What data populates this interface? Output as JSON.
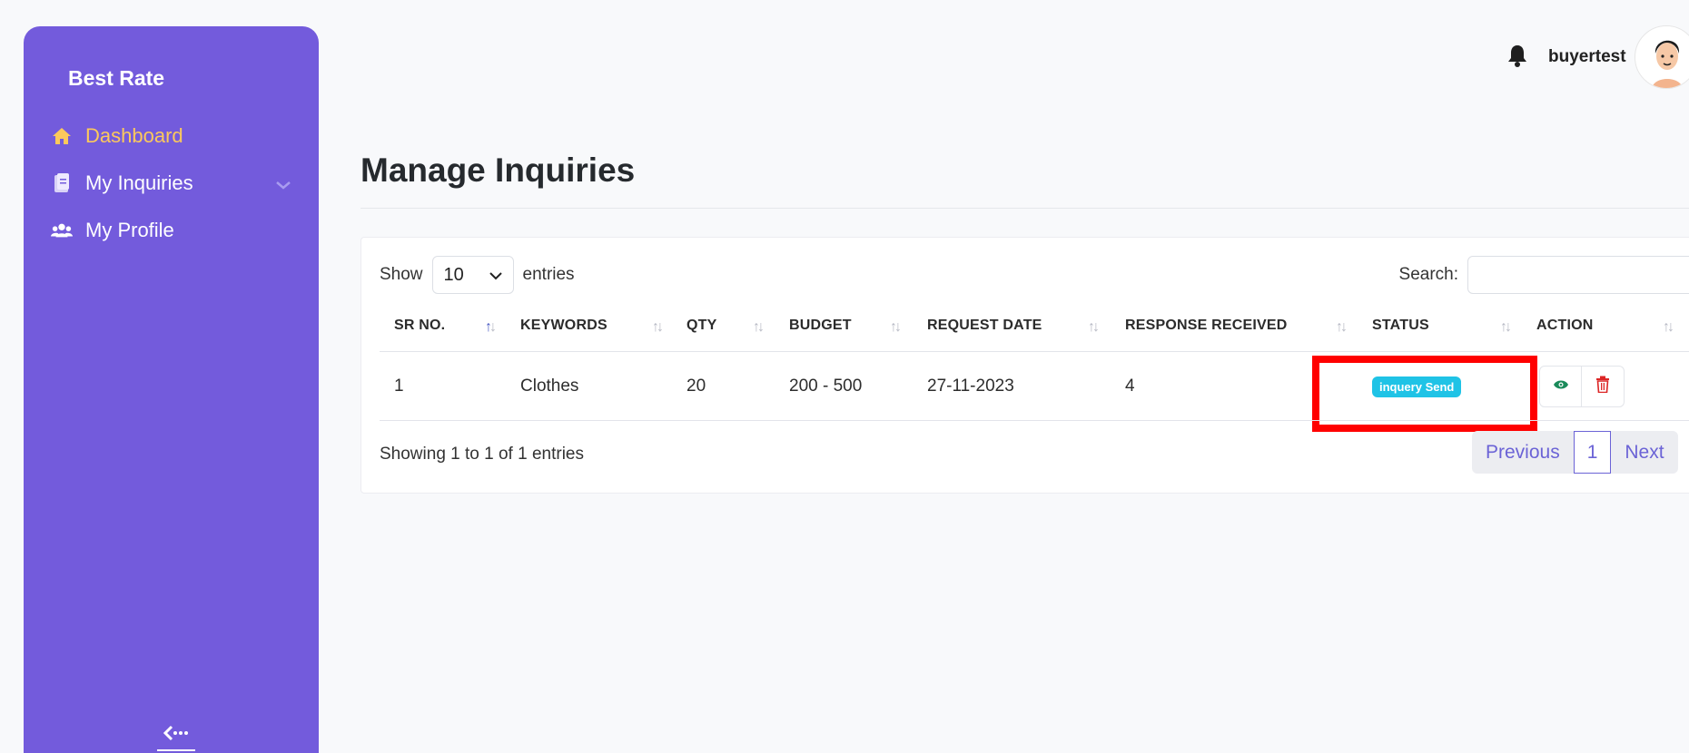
{
  "sidebar": {
    "brand": "Best Rate",
    "items": [
      {
        "label": "Dashboard",
        "icon": "home-icon",
        "active": true
      },
      {
        "label": "My Inquiries",
        "icon": "document-icon",
        "has_submenu": true
      },
      {
        "label": "My Profile",
        "icon": "users-icon"
      }
    ],
    "collapse_icon": "collapse-icon"
  },
  "header": {
    "username": "buyertest",
    "notification_icon": "bell-icon"
  },
  "page": {
    "title": "Manage Inquiries"
  },
  "table_controls": {
    "show_label": "Show",
    "length_value": "10",
    "entries_label": "entries",
    "search_label": "Search:",
    "search_value": ""
  },
  "table": {
    "columns": [
      "SR NO.",
      "KEYWORDS",
      "QTY",
      "BUDGET",
      "REQUEST DATE",
      "RESPONSE RECEIVED",
      "STATUS",
      "ACTION"
    ],
    "rows": [
      {
        "sr_no": "1",
        "keywords": "Clothes",
        "qty": "20",
        "budget": "200 - 500",
        "request_date": "27-11-2023",
        "response_received": "4",
        "status": "inquery Send"
      }
    ]
  },
  "footer": {
    "info": "Showing 1 to 1 of 1 entries",
    "previous": "Previous",
    "page": "1",
    "next": "Next"
  },
  "colors": {
    "sidebar_bg": "#735bdc",
    "active_nav": "#fcc95c",
    "status_badge": "#1fc3e6",
    "highlight": "#ff0000",
    "pager_text": "#6b63d6"
  }
}
